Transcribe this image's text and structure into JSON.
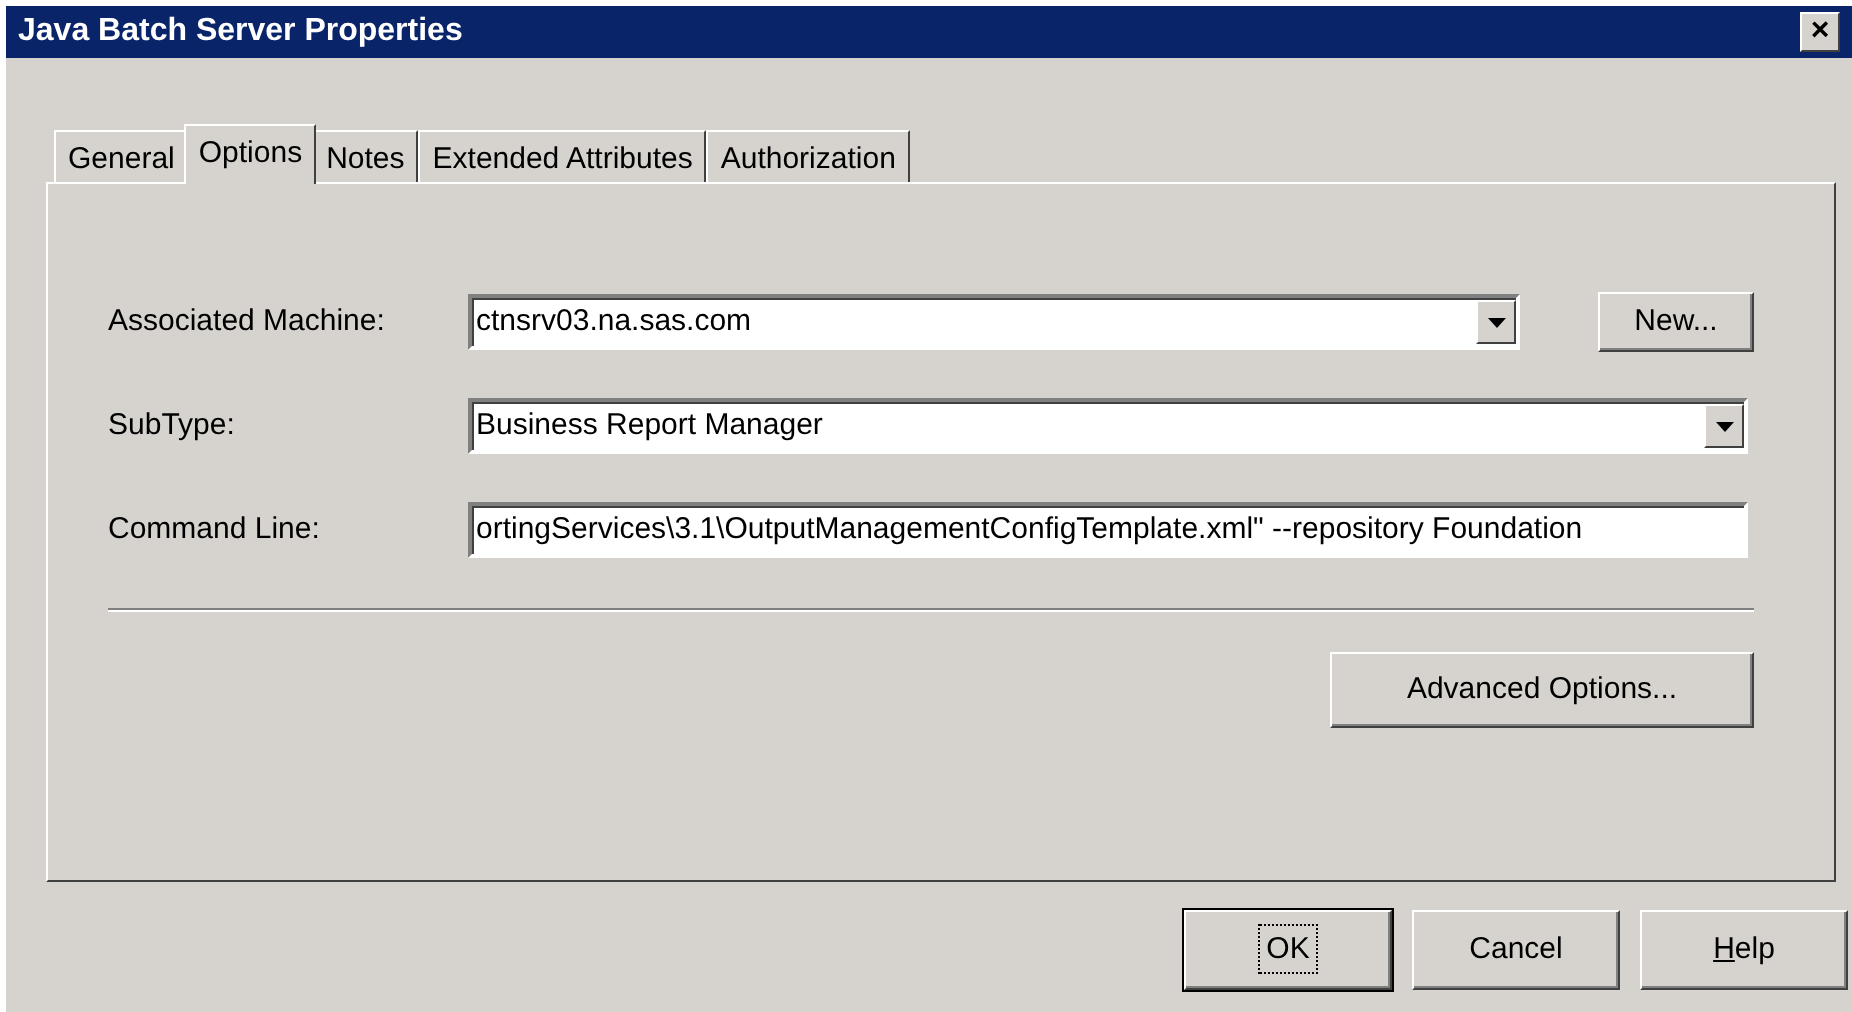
{
  "window": {
    "title": "Java Batch Server Properties",
    "close": "×"
  },
  "tabs": [
    {
      "label": "General",
      "selected": false
    },
    {
      "label": "Options",
      "selected": true
    },
    {
      "label": "Notes",
      "selected": false
    },
    {
      "label": "Extended Attributes",
      "selected": false
    },
    {
      "label": "Authorization",
      "selected": false
    }
  ],
  "fields": [
    {
      "kind": "combo",
      "label": "Associated Machine:",
      "value": "ctnsrv03.na.sas.com",
      "button": "New..."
    },
    {
      "kind": "combo",
      "label": "SubType:",
      "value": "Business Report Manager"
    },
    {
      "kind": "text",
      "label": "Command Line:",
      "value": "ortingServices\\3.1\\OutputManagementConfigTemplate.xml\" --repository Foundation"
    }
  ],
  "advanced_button": "Advanced Options...",
  "buttons": [
    {
      "label": "OK",
      "default": true
    },
    {
      "label": "Cancel",
      "default": false
    },
    {
      "label": "Help",
      "default": false,
      "first_letter_underlined": true
    }
  ]
}
